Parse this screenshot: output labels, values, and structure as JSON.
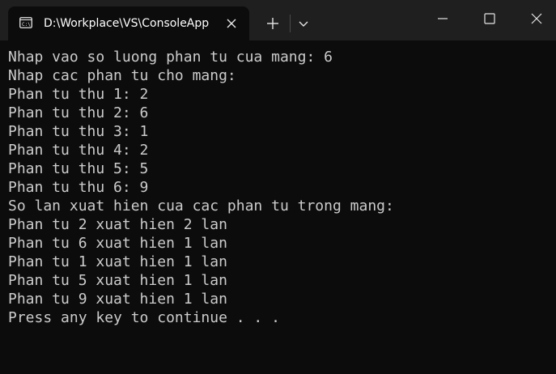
{
  "tab": {
    "title": "D:\\Workplace\\VS\\ConsoleApp",
    "icon": "console-app-icon"
  },
  "colors": {
    "titlebar": "#1f1f1f",
    "console_bg": "#0c0c0c",
    "console_text": "#cccccc",
    "tab_text": "#ffffff"
  },
  "console": {
    "lines": [
      "Nhap vao so luong phan tu cua mang: 6",
      "Nhap cac phan tu cho mang:",
      "Phan tu thu 1: 2",
      "Phan tu thu 2: 6",
      "Phan tu thu 3: 1",
      "Phan tu thu 4: 2",
      "Phan tu thu 5: 5",
      "Phan tu thu 6: 9",
      "So lan xuat hien cua cac phan tu trong mang:",
      "Phan tu 2 xuat hien 2 lan",
      "Phan tu 6 xuat hien 1 lan",
      "Phan tu 1 xuat hien 1 lan",
      "Phan tu 5 xuat hien 1 lan",
      "Phan tu 9 xuat hien 1 lan",
      "Press any key to continue . . ."
    ]
  }
}
